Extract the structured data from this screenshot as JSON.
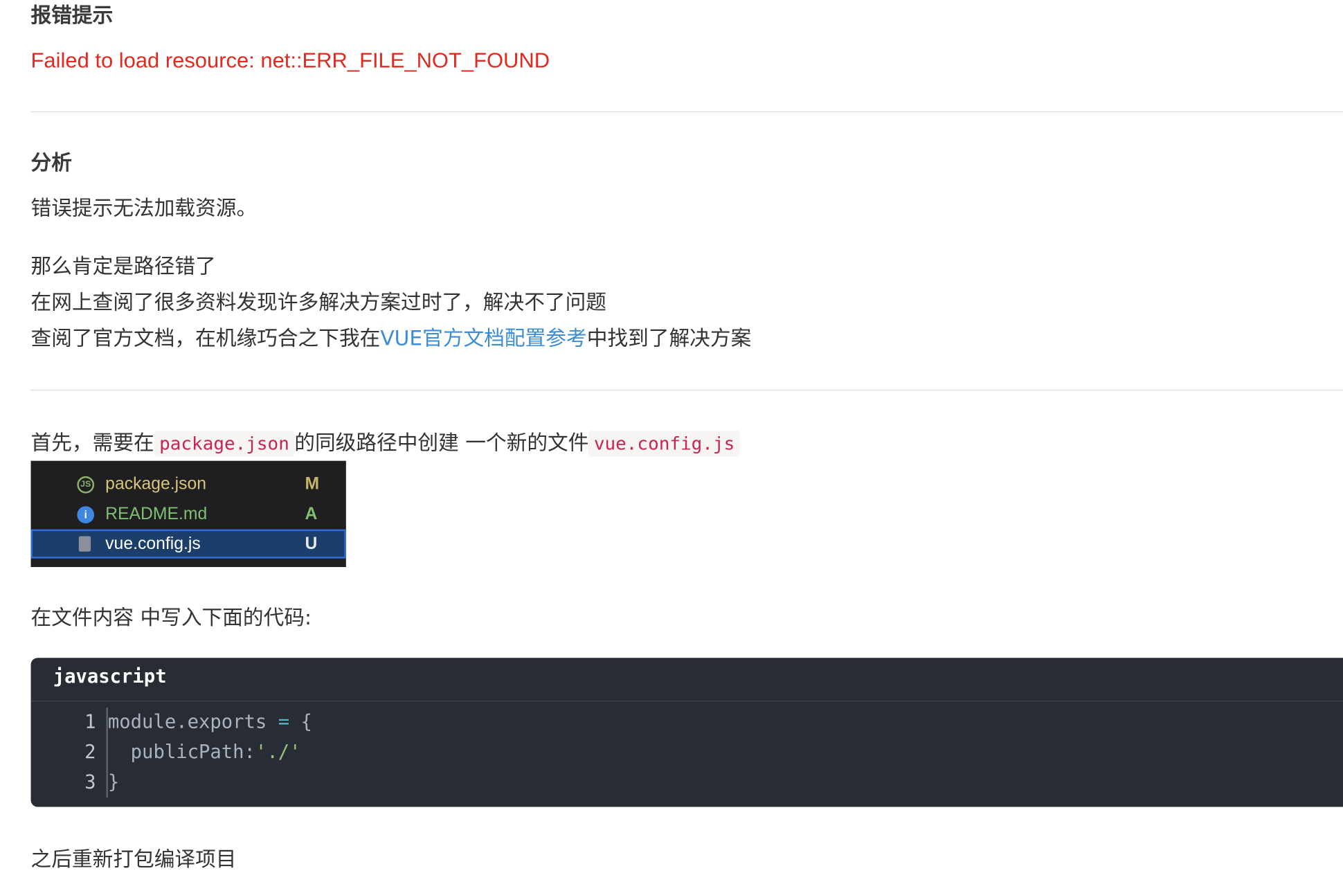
{
  "section_error": {
    "heading": "报错提示",
    "message": "Failed to load resource: net::ERR_FILE_NOT_FOUND"
  },
  "section_analysis": {
    "heading": "分析",
    "para1": "错误提示无法加载资源。",
    "line1": "那么肯定是路径错了",
    "line2": "在网上查阅了很多资料发现许多解决方案过时了，解决不了问题",
    "line3_before": "查阅了官方文档，在机缘巧合之下我在",
    "line3_link": "VUE官方文档配置参考",
    "line3_after": "中找到了解决方案"
  },
  "section_solution": {
    "intro_before": "首先，需要在",
    "intro_code1": "package.json",
    "intro_middle": "的同级路径中创建 一个新的文件",
    "intro_code2": "vue.config.js",
    "explorer": [
      {
        "name": "package.json",
        "status": "M",
        "icon": "json-file-icon",
        "color": "#d8c47a",
        "status_color": "#c8b46a"
      },
      {
        "name": "README.md",
        "status": "A",
        "icon": "info-icon",
        "color": "#7fbf6f",
        "status_color": "#7fbf6f"
      },
      {
        "name": "vue.config.js",
        "status": "U",
        "icon": "js-file-icon",
        "color": "#ffffff",
        "status_color": "#e8e8e8"
      }
    ],
    "write_code_text": "在文件内容 中写入下面的代码:",
    "code_lang": "javascript",
    "code_line_numbers": [
      "1",
      "2",
      "3"
    ],
    "code": {
      "l1_a": "module.exports ",
      "l1_op": "=",
      "l1_b": " {",
      "l2_a": "  publicPath:",
      "l2_str": "'./'",
      "l3": "}"
    },
    "after_text": "之后重新打包编译项目"
  },
  "colors": {
    "error_red": "#e0291f",
    "link_blue": "#3c8dd6",
    "inline_code": "#c7254e",
    "code_bg": "#282c34"
  }
}
